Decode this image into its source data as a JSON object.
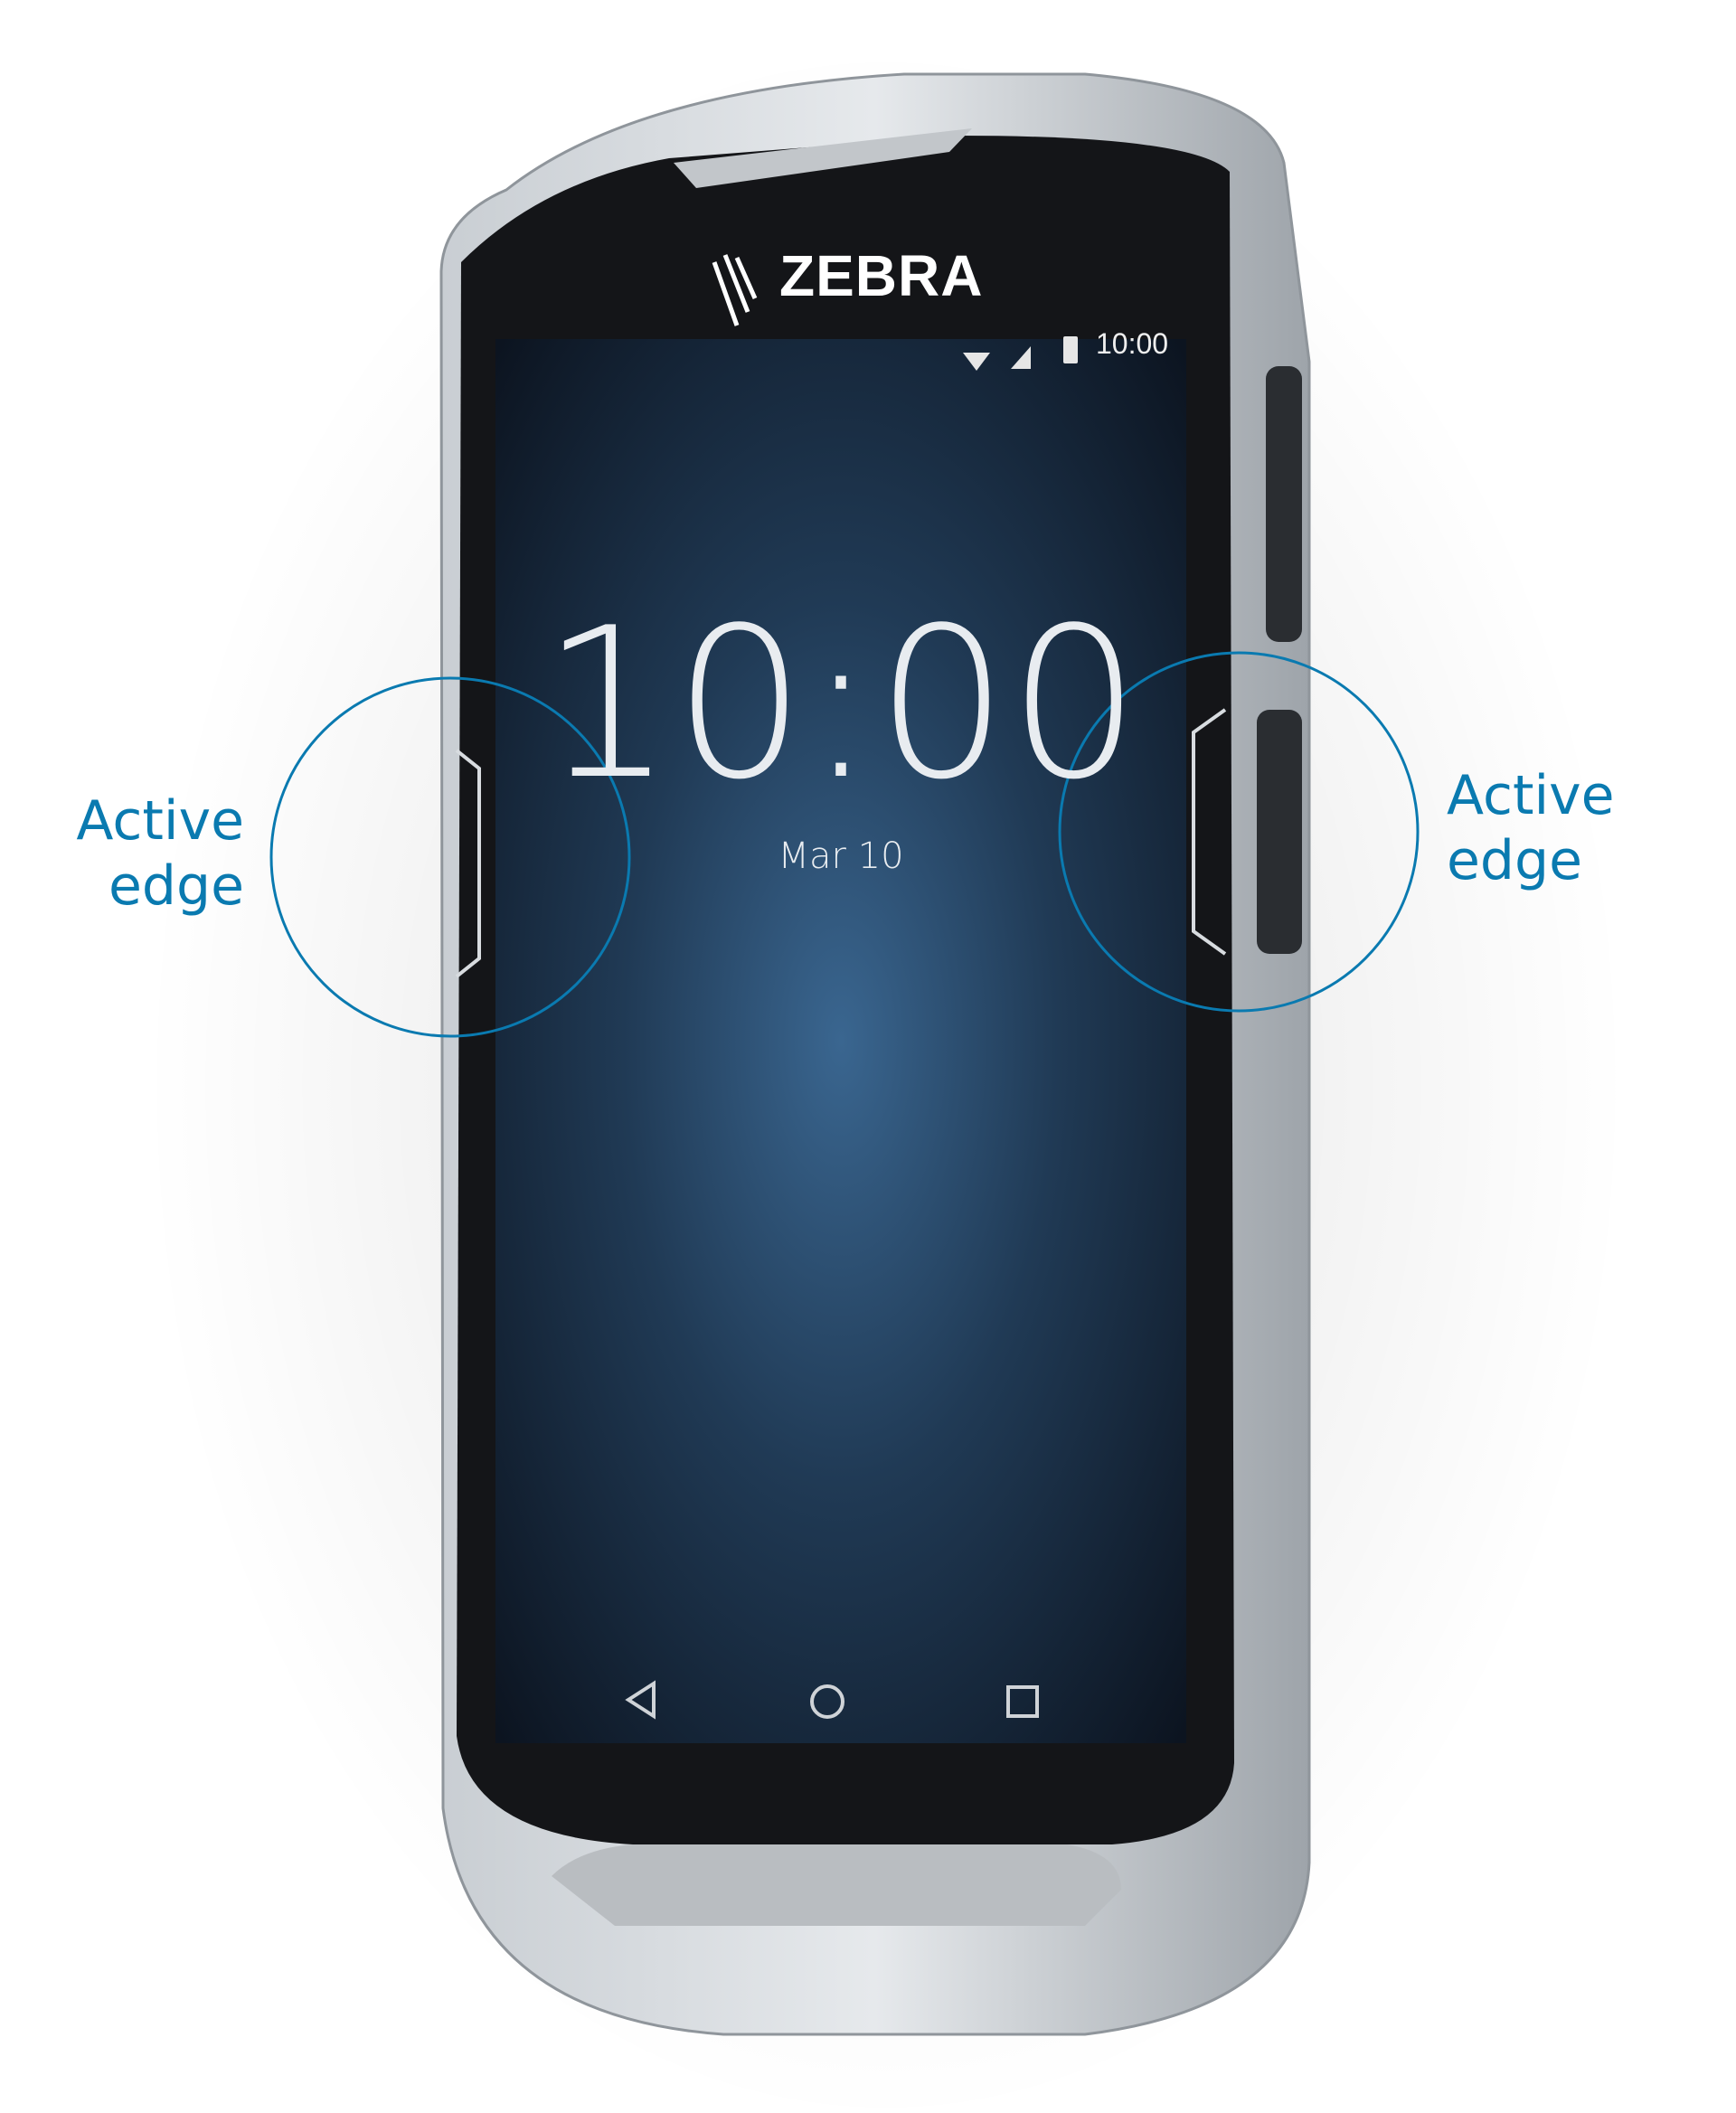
{
  "device": {
    "brand": "ZEBRA",
    "status_bar": {
      "time": "10:00",
      "icons": [
        "wifi-icon",
        "cellular-signal-icon",
        "battery-icon"
      ]
    },
    "lock_screen": {
      "time": "10:00",
      "date": "Mar 10"
    },
    "nav_bar": {
      "icons": [
        "back-icon",
        "home-icon",
        "recents-icon"
      ]
    }
  },
  "callouts": {
    "left": {
      "line1": "Active",
      "line2": "edge"
    },
    "right": {
      "line1": "Active",
      "line2": "edge"
    },
    "color": "#0a7ab0"
  }
}
